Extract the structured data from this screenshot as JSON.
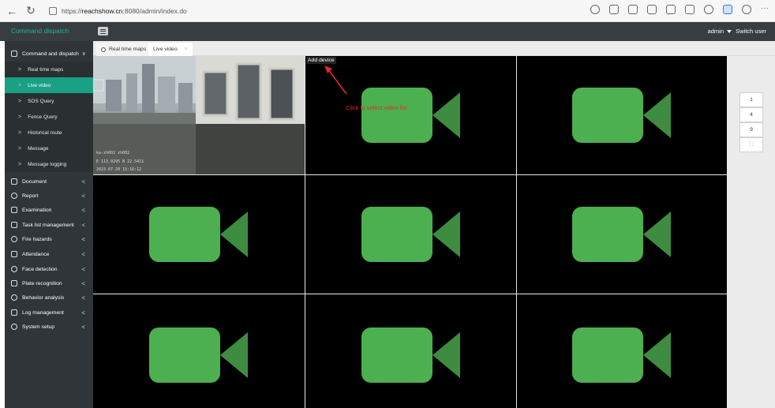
{
  "browser": {
    "url_scheme": "https://",
    "url_host": "reachshow.cn",
    "url_rest": ":8080/admin/index.do"
  },
  "header": {
    "app_title": "Command dispatch",
    "user": "admin",
    "switch_user": "Switch user"
  },
  "sidebar": {
    "groups": [
      {
        "label": "Command and dispatch",
        "icon": "monitor-icon"
      },
      {
        "label": "Document",
        "icon": "folder-icon"
      },
      {
        "label": "Report",
        "icon": "clock-icon"
      },
      {
        "label": "Examination",
        "icon": "clipboard-icon"
      },
      {
        "label": "Task list management",
        "icon": "checklist-icon"
      },
      {
        "label": "Fire hazards",
        "icon": "flame-icon"
      },
      {
        "label": "Attendance",
        "icon": "calendar-icon"
      },
      {
        "label": "Face detection",
        "icon": "face-icon"
      },
      {
        "label": "Plate recognition",
        "icon": "plate-icon"
      },
      {
        "label": "Behavior analysis",
        "icon": "behavior-icon"
      },
      {
        "label": "Log management",
        "icon": "log-icon"
      },
      {
        "label": "System setup",
        "icon": "gear-icon"
      }
    ],
    "sub_items": [
      {
        "label": "Real time maps"
      },
      {
        "label": "Live video",
        "active": true
      },
      {
        "label": "SOS Query"
      },
      {
        "label": "Fence Query"
      },
      {
        "label": "Historical route"
      },
      {
        "label": "Message"
      },
      {
        "label": "Message logging"
      }
    ]
  },
  "tabs": [
    {
      "label": "Real time maps",
      "icon": "map-pin-icon"
    },
    {
      "label": "Live video",
      "active": true
    }
  ],
  "video": {
    "live_osd": [
      "ka-zh002 zh002",
      "E 113.9295 N 22.5411",
      "2023-07-20 15:16:12"
    ],
    "add_device": "Add device",
    "annotation": "Click to select video list",
    "camera_color": "#4caf50",
    "camera_shadow": "#3d8c40"
  },
  "split": [
    "1",
    "4",
    "9",
    "⛶"
  ]
}
